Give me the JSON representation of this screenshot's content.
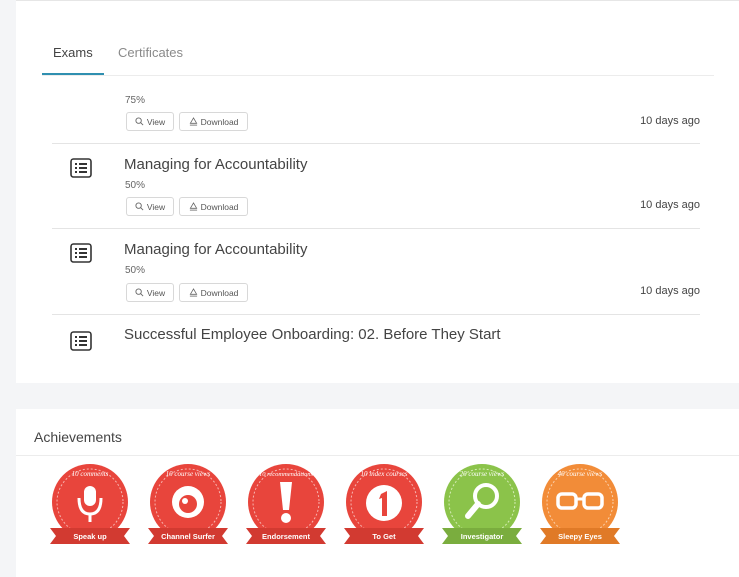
{
  "tabs": [
    {
      "label": "Exams",
      "active": true
    },
    {
      "label": "Certificates",
      "active": false
    }
  ],
  "buttons": {
    "view": "View",
    "download": "Download"
  },
  "exams": [
    {
      "title": "",
      "score": "75%",
      "time": "10 days ago"
    },
    {
      "title": "Managing for Accountability",
      "score": "50%",
      "time": "10 days ago"
    },
    {
      "title": "Managing for Accountability",
      "score": "50%",
      "time": "10 days ago"
    },
    {
      "title": "Successful Employee Onboarding: 02. Before They Start",
      "score": "",
      "time": ""
    }
  ],
  "achievements": {
    "title": "Achievements",
    "badges": [
      {
        "arc": "10 comments",
        "name": "Speak up",
        "color": "#e8453c",
        "icon": "microphone-icon"
      },
      {
        "arc": "10 course views",
        "name": "Channel Surfer",
        "color": "#e8453c",
        "icon": "eye-icon"
      },
      {
        "arc": "10 recommendations",
        "name": "Endorsement",
        "color": "#e8453c",
        "icon": "exclamation-icon"
      },
      {
        "arc": "10 index courses",
        "name": "To Get",
        "color": "#e8453c",
        "icon": "number-one-icon"
      },
      {
        "arc": "20 course views",
        "name": "Investigator",
        "color": "#8bc34a",
        "icon": "magnifier-icon"
      },
      {
        "arc": "40 course views",
        "name": "Sleepy Eyes",
        "color": "#f28c38",
        "icon": "glasses-icon"
      }
    ]
  },
  "colors": {
    "tab_accent": "#2f8fb0"
  }
}
